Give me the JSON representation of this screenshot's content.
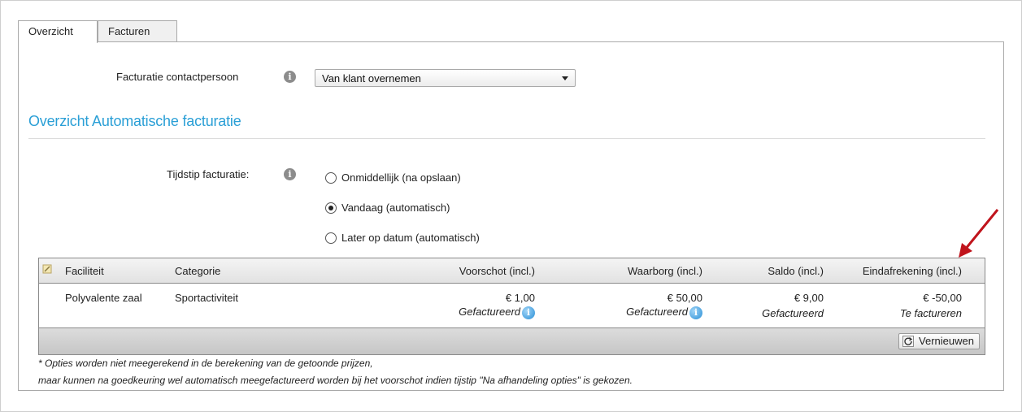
{
  "tabs": [
    {
      "label": "Overzicht",
      "active": true
    },
    {
      "label": "Facturen",
      "active": false
    }
  ],
  "contact": {
    "label": "Facturatie contactpersoon",
    "select_value": "Van klant overnemen"
  },
  "section_title": "Overzicht Automatische facturatie",
  "timing": {
    "label": "Tijdstip facturatie:",
    "options": [
      {
        "label": "Onmiddellijk (na opslaan)",
        "checked": false
      },
      {
        "label": "Vandaag (automatisch)",
        "checked": true
      },
      {
        "label": "Later op datum (automatisch)",
        "checked": false
      }
    ]
  },
  "table": {
    "headers": {
      "faciliteit": "Faciliteit",
      "categorie": "Categorie",
      "voorschot": "Voorschot (incl.)",
      "waarborg": "Waarborg (incl.)",
      "saldo": "Saldo (incl.)",
      "eindafrekening": "Eindafrekening (incl.)"
    },
    "row": {
      "faciliteit": "Polyvalente zaal",
      "categorie": "Sportactiviteit",
      "voorschot_amount": "€ 1,00",
      "voorschot_status": "Gefactureerd",
      "waarborg_amount": "€ 50,00",
      "waarborg_status": "Gefactureerd",
      "saldo_amount": "€ 9,00",
      "saldo_status": "Gefactureerd",
      "eind_amount": "€ -50,00",
      "eind_status": "Te factureren"
    },
    "refresh_label": "Vernieuwen"
  },
  "notes": {
    "line1": "* Opties worden niet meegerekend in de berekening van de getoonde prijzen,",
    "line2": "maar kunnen na goedkeuring wel automatisch meegefactureerd worden bij het voorschot indien tijstip \"Na afhandeling opties\" is gekozen."
  },
  "colors": {
    "accent": "#2a9fd6",
    "annotation_arrow": "#c0141c"
  }
}
